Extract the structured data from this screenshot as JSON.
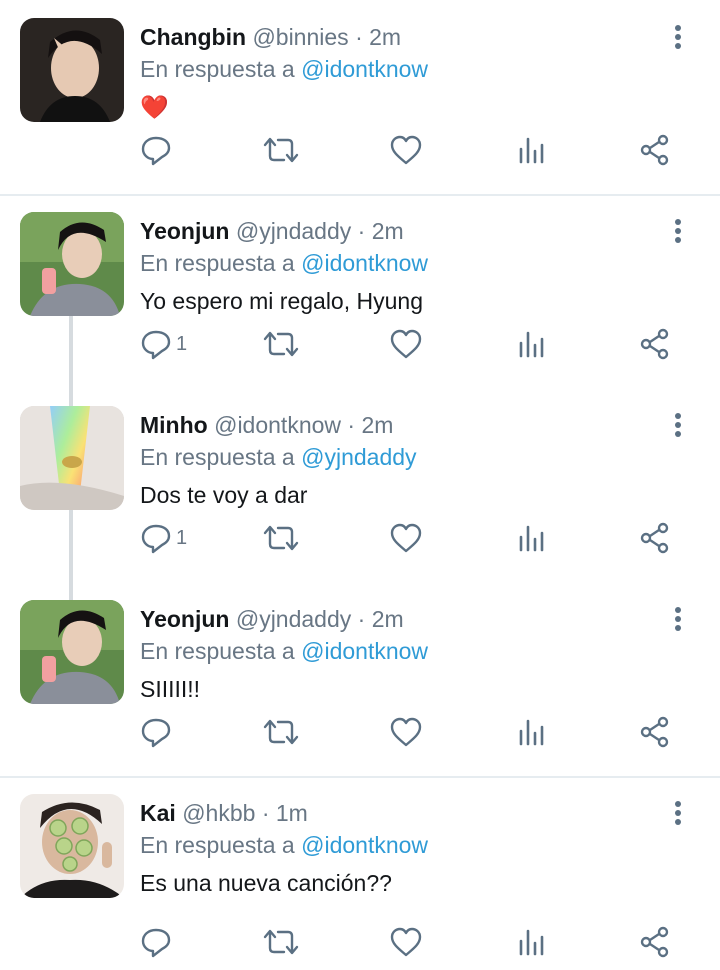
{
  "colors": {
    "link": "#2f9bd6",
    "muted": "#687684",
    "icon": "#5b7083",
    "heart": "#e0245e",
    "divider": "#e6ecf0",
    "thread": "#d6dbdf"
  },
  "reply_prefix": "En respuesta a",
  "tweets": [
    {
      "name": "Changbin",
      "handle": "@binnies",
      "time": "2m",
      "reply_to": "@idontknow",
      "text": "❤️",
      "reply_count": ""
    },
    {
      "name": "Yeonjun",
      "handle": "@yjndaddy",
      "time": "2m",
      "reply_to": "@idontknow",
      "text": "Yo espero mi regalo, Hyung",
      "reply_count": "1"
    },
    {
      "name": "Minho",
      "handle": "@idontknow",
      "time": "2m",
      "reply_to": "@yjndaddy",
      "text": "Dos te voy a dar",
      "reply_count": "1"
    },
    {
      "name": "Yeonjun",
      "handle": "@yjndaddy",
      "time": "2m",
      "reply_to": "@idontknow",
      "text": "SIIIII!!",
      "reply_count": ""
    },
    {
      "name": "Kai",
      "handle": "@hkbb",
      "time": "1m",
      "reply_to": "@idontknow",
      "text": "Es una nueva canción??",
      "reply_count": ""
    }
  ],
  "action_icons": [
    "reply-icon",
    "retweet-icon",
    "like-icon",
    "analytics-icon",
    "share-icon"
  ],
  "dot_separator": "·"
}
